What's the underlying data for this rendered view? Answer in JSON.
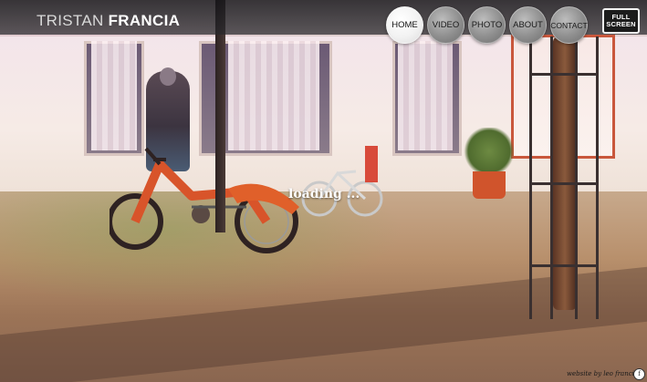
{
  "site": {
    "title_light": "TRISTAN ",
    "title_bold": "FRANCIA"
  },
  "nav": {
    "items": [
      {
        "label": "HOME",
        "active": true
      },
      {
        "label": "VIDEO",
        "active": false
      },
      {
        "label": "PHOTO",
        "active": false
      },
      {
        "label": "ABOUT",
        "active": false
      },
      {
        "label": "CONTACT",
        "active": false
      }
    ],
    "fullscreen_line1": "FULL",
    "fullscreen_line2": "SCREEN"
  },
  "status": {
    "loading_text": "loading ..."
  },
  "footer": {
    "credit": "website by leo francia",
    "credit_icon": "f"
  },
  "background": {
    "description_icon": "photo-background-icon"
  },
  "colors": {
    "topbar": "#1e1e22",
    "nav_active": "#f2f2f2",
    "nav_inactive": "#8e8e8e"
  }
}
